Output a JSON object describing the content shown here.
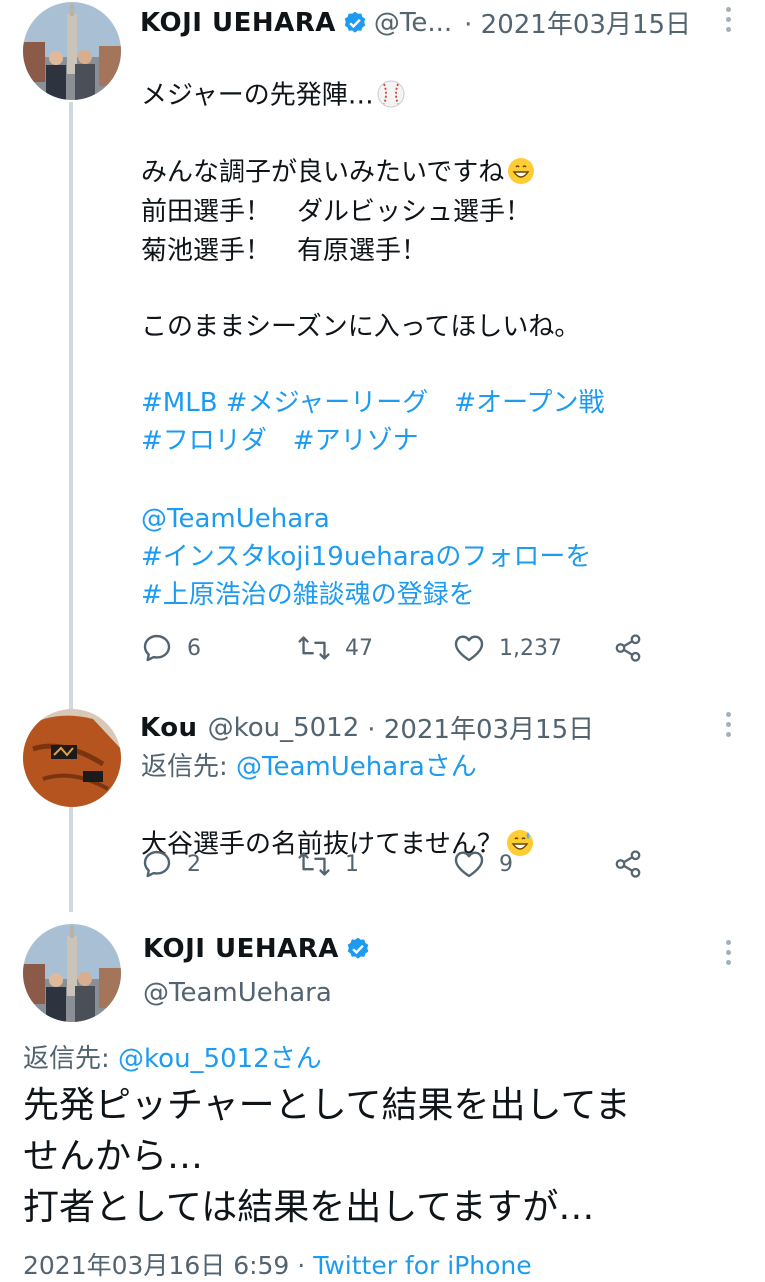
{
  "tweet1": {
    "name": "KOJI  UEHARA",
    "handle": "@Te...",
    "date": "· 2021年03月15日",
    "body_line1": "メジャーの先発陣…",
    "body_line2": "みんな調子が良いみたいですね",
    "body_line3": "前田選手！　ダルビッシュ選手！\n菊池選手！　有原選手！",
    "body_line4": "このままシーズンに入ってほしいね。",
    "tags_line1": "#MLB   #メジャーリーグ　#オープン戦",
    "tags_line2": "#フロリダ　#アリゾナ",
    "mention": "@TeamUehara",
    "tags_line3": "#インスタkoji19ueharaのフォローを",
    "tags_line4": "#上原浩治の雑談魂の登録を",
    "replies": "6",
    "retweets": "47",
    "likes": "1,237"
  },
  "tweet2": {
    "name": "Kou",
    "handle": "@kou_5012",
    "date": "· 2021年03月15日",
    "reply_prefix": "返信先: ",
    "reply_to": "@TeamUeharaさん",
    "body": "大谷選手の名前抜けてません？",
    "replies": "2",
    "retweets": "1",
    "likes": "9"
  },
  "main_tweet": {
    "name": "KOJI  UEHARA",
    "handle": "@TeamUehara",
    "reply_prefix": "返信先: ",
    "reply_to": "@kou_5012さん",
    "body": "先発ピッチャーとして結果を出してま\nせんから…\n打者としては結果を出してますが…",
    "timestamp": "2021年03月16日 6:59",
    "separator": " · ",
    "source": "Twitter for iPhone"
  },
  "icons": [
    "verified-badge-icon",
    "more-icon",
    "baseball-emoji",
    "grinning-emoji",
    "sweat-smile-emoji",
    "reply-icon",
    "retweet-icon",
    "like-icon",
    "share-icon"
  ],
  "colors": {
    "link": "#1d9bf0",
    "muted": "#536471",
    "thread_line": "#cfd9de",
    "verified": "#1d9bf0"
  }
}
